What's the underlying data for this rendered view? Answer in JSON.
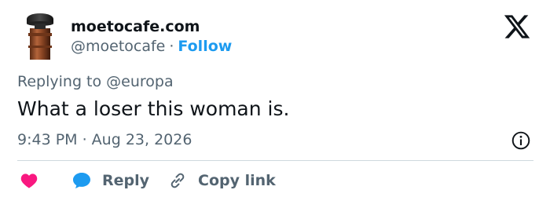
{
  "author": {
    "display_name": "moetocafe.com",
    "handle": "@moetocafe",
    "separator": "·",
    "follow_label": "Follow"
  },
  "tweet": {
    "replying_to": "Replying to @europa",
    "text": "What a loser this woman is.",
    "timestamp": "9:43 PM · Aug 23, 2026"
  },
  "actions": {
    "reply_label": "Reply",
    "copy_link_label": "Copy link"
  },
  "icons": {
    "brand": "x-logo-icon",
    "info": "info-icon",
    "like": "heart-icon",
    "reply": "speech-bubble-icon",
    "copy": "link-icon"
  },
  "colors": {
    "link": "#1d9bf0",
    "like": "#f91880",
    "muted_text": "#536471",
    "text": "#0f1419"
  }
}
